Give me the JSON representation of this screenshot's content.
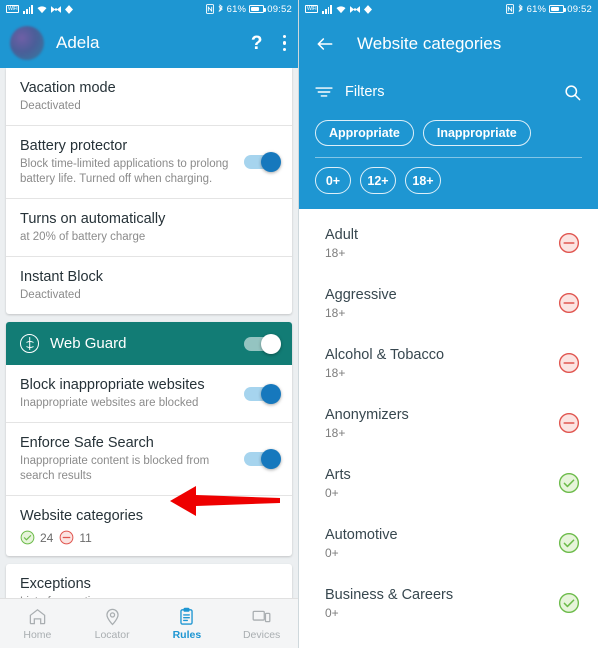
{
  "status_bar": {
    "wifi_label": "WIFI",
    "icons": [
      "wifi-box-icon",
      "signal-bars-icon",
      "wifi-icon",
      "vpn-icon",
      "diamond-icon"
    ],
    "nfc_icon": "nfc-icon",
    "bluetooth_glyph": "ʙ",
    "battery_percent": "61%",
    "time": "09:52"
  },
  "left": {
    "appbar": {
      "user_name": "Adela",
      "help_label": "?",
      "overflow_label": "more-options"
    },
    "settings": [
      {
        "title": "Vacation mode",
        "subtitle": "Deactivated",
        "toggle": null
      },
      {
        "title": "Battery protector",
        "subtitle": "Block time-limited applications to prolong battery life. Turned off when charging.",
        "toggle": "on"
      },
      {
        "title": "Turns on automatically",
        "subtitle": "at 20% of battery charge",
        "toggle": null
      },
      {
        "title": "Instant Block",
        "subtitle": "Deactivated",
        "toggle": null
      }
    ],
    "web_guard": {
      "title": "Web Guard",
      "toggle": "on",
      "rows": [
        {
          "title": "Block inappropriate websites",
          "subtitle": "Inappropriate websites are blocked",
          "toggle": "on"
        },
        {
          "title": "Enforce Safe Search",
          "subtitle": "Inappropriate content is blocked from search results",
          "toggle": "on"
        }
      ],
      "categories_row": {
        "title": "Website categories",
        "allowed_count": "24",
        "blocked_count": "11"
      },
      "exceptions_row": {
        "title": "Exceptions",
        "subtitle": "List of exceptions"
      }
    },
    "bottom_nav": [
      {
        "label": "Home",
        "icon": "home-icon",
        "active": false
      },
      {
        "label": "Locator",
        "icon": "location-pin-icon",
        "active": false
      },
      {
        "label": "Rules",
        "icon": "clipboard-icon",
        "active": true
      },
      {
        "label": "Devices",
        "icon": "devices-icon",
        "active": false
      }
    ],
    "annotation": {
      "type": "red-arrow",
      "direction": "left",
      "color": "#EE0000"
    }
  },
  "right": {
    "appbar": {
      "back_label": "back",
      "title": "Website categories",
      "filters_label": "Filters",
      "search_label": "search"
    },
    "chips": [
      {
        "label": "Appropriate"
      },
      {
        "label": "Inappropriate"
      }
    ],
    "age_chips": [
      {
        "label": "0+"
      },
      {
        "label": "12+"
      },
      {
        "label": "18+"
      }
    ],
    "categories": [
      {
        "name": "Adult",
        "age": "18+",
        "state": "blocked"
      },
      {
        "name": "Aggressive",
        "age": "18+",
        "state": "blocked"
      },
      {
        "name": "Alcohol & Tobacco",
        "age": "18+",
        "state": "blocked"
      },
      {
        "name": "Anonymizers",
        "age": "18+",
        "state": "blocked"
      },
      {
        "name": "Arts",
        "age": "0+",
        "state": "allowed"
      },
      {
        "name": "Automotive",
        "age": "0+",
        "state": "allowed"
      },
      {
        "name": "Business & Careers",
        "age": "0+",
        "state": "allowed"
      }
    ]
  },
  "colors": {
    "primary_blue": "#1E96D2",
    "teal": "#127c75",
    "toggle_blue": "#1678bd",
    "allowed_green": "#6cbb4a",
    "blocked_red": "#e0554f",
    "annotation_red": "#EE0000"
  }
}
